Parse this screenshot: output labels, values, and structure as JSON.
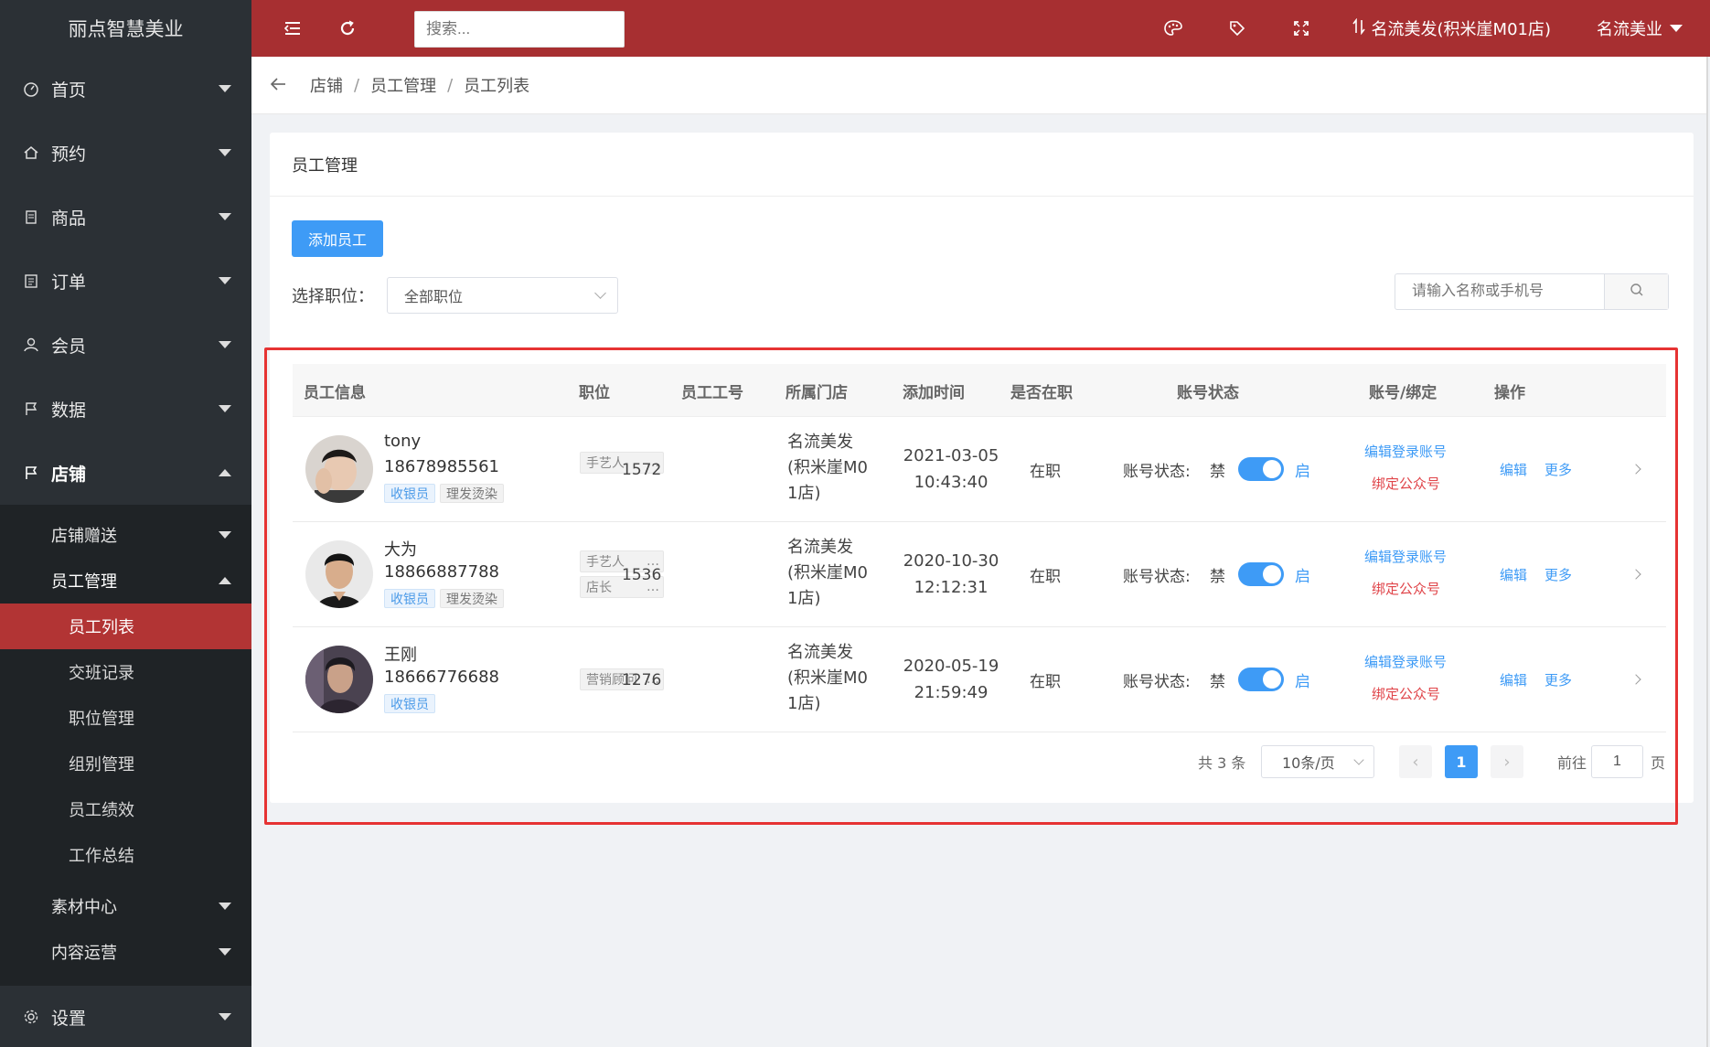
{
  "brand": "丽点智慧美业",
  "sidebar": {
    "items": [
      {
        "label": "首页",
        "icon": "dashboard-icon"
      },
      {
        "label": "预约",
        "icon": "home-icon"
      },
      {
        "label": "商品",
        "icon": "document-icon"
      },
      {
        "label": "订单",
        "icon": "clipboard-icon"
      },
      {
        "label": "会员",
        "icon": "user-icon"
      },
      {
        "label": "数据",
        "icon": "flag-icon"
      },
      {
        "label": "店铺",
        "icon": "flag-icon"
      }
    ],
    "sub_items": [
      "店铺赠送",
      "员工管理"
    ],
    "leaves": [
      "员工列表",
      "交班记录",
      "职位管理",
      "组别管理",
      "员工绩效",
      "工作总结"
    ],
    "more_sub_items": [
      "素材中心",
      "内容运营"
    ],
    "settings": "设置"
  },
  "topbar": {
    "search_placeholder": "搜索...",
    "store_name": "名流美发(积米崖M01店)",
    "user_name": "名流美业"
  },
  "breadcrumb": [
    "店铺",
    "员工管理",
    "员工列表"
  ],
  "card": {
    "title": "员工管理",
    "add_button": "添加员工",
    "filter_label": "选择职位：",
    "filter_value": "全部职位",
    "search_placeholder": "请输入名称或手机号"
  },
  "table": {
    "headers": [
      "员工信息",
      "职位",
      "员工工号",
      "所属门店",
      "添加时间",
      "是否在职",
      "账号状态",
      "账号/绑定",
      "操作"
    ],
    "rows": [
      {
        "name": "tony",
        "phone": "18678985561",
        "tags": [
          "收银员",
          "理发烫染"
        ],
        "positions": [
          "手艺人"
        ],
        "emp_no": "1572",
        "store": "名流美发(积米崖M01店)",
        "store_lines": [
          "名流美发",
          "(积米崖M0",
          "1店)"
        ],
        "date": "2021-03-05",
        "time": "10:43:40",
        "employed": "在职",
        "status_label": "账号状态:",
        "off_label": "禁",
        "on_label": "启",
        "link1": "编辑登录账号",
        "link2": "绑定公众号",
        "edit": "编辑",
        "more": "更多"
      },
      {
        "name": "大为",
        "phone": "18866887788",
        "tags": [
          "收银员",
          "理发烫染"
        ],
        "positions": [
          "手艺人",
          "店长"
        ],
        "emp_no": "1536",
        "store": "名流美发(积米崖M01店)",
        "store_lines": [
          "名流美发",
          "(积米崖M0",
          "1店)"
        ],
        "date": "2020-10-30",
        "time": "12:12:31",
        "employed": "在职",
        "status_label": "账号状态:",
        "off_label": "禁",
        "on_label": "启",
        "link1": "编辑登录账号",
        "link2": "绑定公众号",
        "edit": "编辑",
        "more": "更多"
      },
      {
        "name": "王刚",
        "phone": "18666776688",
        "tags": [
          "收银员"
        ],
        "positions": [
          "营销顾问"
        ],
        "emp_no": "1276",
        "store": "名流美发(积米崖M01店)",
        "store_lines": [
          "名流美发",
          "(积米崖M0",
          "1店)"
        ],
        "date": "2020-05-19",
        "time": "21:59:49",
        "employed": "在职",
        "status_label": "账号状态:",
        "off_label": "禁",
        "on_label": "启",
        "link1": "编辑登录账号",
        "link2": "绑定公众号",
        "edit": "编辑",
        "more": "更多"
      }
    ]
  },
  "pagination": {
    "total": "共 3 条",
    "page_size": "10条/页",
    "current_page": "1",
    "goto_label": "前往",
    "goto_value": "1",
    "page_suffix": "页"
  },
  "colors": {
    "topbar": "#a72f31",
    "sidebar": "#2b3035",
    "active_leaf": "#b23434",
    "primary": "#3e9bf6",
    "danger_link": "#e0454a",
    "highlight_frame": "#e63333"
  }
}
